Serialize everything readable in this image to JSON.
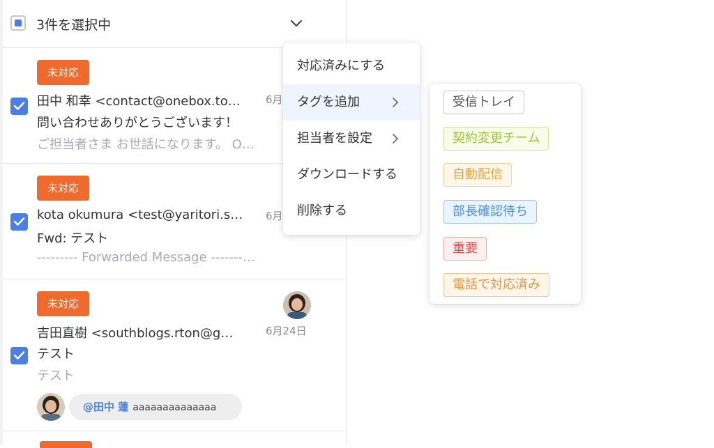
{
  "header": {
    "selected_label": "3件を選択中"
  },
  "items": [
    {
      "status": "未対応",
      "sender": "田中 和幸 <contact@onebox.to…",
      "date": "6月",
      "subject": "問い合わせありがとうございます！",
      "preview": "ご担当者さま お世話になります。 O…"
    },
    {
      "status": "未対応",
      "sender": "kota okumura <test@yaritori.s…",
      "date": "6月",
      "subject": "Fwd: テスト",
      "preview": "--------- Forwarded Message -------…"
    },
    {
      "status": "未対応",
      "sender": "吉田直樹 <southblogs.rton@g…",
      "date": "6月24日",
      "subject": "テスト",
      "preview": "テスト",
      "mention": {
        "name": "@田中 蓮",
        "text": "aaaaaaaaaaaaaa"
      }
    }
  ],
  "action_menu": [
    {
      "label": "対応済みにする"
    },
    {
      "label": "タグを追加",
      "submenu": true
    },
    {
      "label": "担当者を設定",
      "submenu": true
    },
    {
      "label": "ダウンロードする"
    },
    {
      "label": "削除する"
    }
  ],
  "tags": [
    {
      "label": "受信トレイ",
      "color": "#555555",
      "bg": "#ffffff",
      "border": "#c9c9c9"
    },
    {
      "label": "契約変更チーム",
      "color": "#9bc53d",
      "bg": "#f7fde9",
      "border": "#cde88a"
    },
    {
      "label": "自動配信",
      "color": "#e8a33b",
      "bg": "#fff8ea",
      "border": "#f5d38f"
    },
    {
      "label": "部長確認待ち",
      "color": "#4a90e2",
      "bg": "#eaf4ff",
      "border": "#9cc7f5"
    },
    {
      "label": "重要",
      "color": "#e0504a",
      "bg": "#fff0ef",
      "border": "#f3a9a5"
    },
    {
      "label": "電話で対応済み",
      "color": "#e8963b",
      "bg": "#fff5e8",
      "border": "#f5c88f"
    }
  ],
  "colors": {
    "accent": "#4a7fe8",
    "status": "#f06a2d"
  }
}
